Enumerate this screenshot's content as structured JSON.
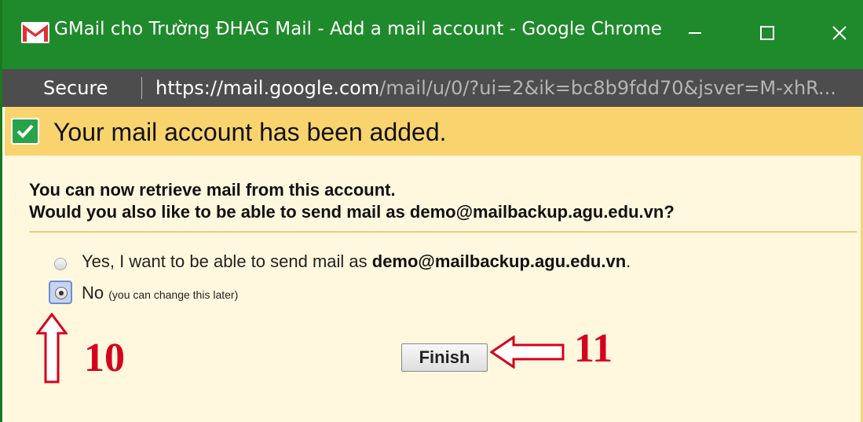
{
  "window": {
    "title": "GMail cho Trường ĐHAG Mail - Add a mail account - Google Chrome",
    "minimize_label": "—",
    "maximize_label": "☐",
    "close_label": "✕"
  },
  "addressbar": {
    "secure_label": "Secure",
    "url_scheme": "https://",
    "url_host": "mail.google.com",
    "url_path": "/mail/u/0/?ui=2&ik=bc8b9fdd70&jsver=M-xhR..."
  },
  "dialog": {
    "header": "Your mail account has been added.",
    "message_line1": "You can now retrieve mail from this account.",
    "message_line2": "Would you also like to be able to send mail as demo@mailbackup.agu.edu.vn?",
    "option_yes_prefix": "Yes, I want to be able to send mail as ",
    "option_yes_email": "demo@mailbackup.agu.edu.vn",
    "option_yes_suffix": ".",
    "option_no_label": "No",
    "option_no_hint": "(you can change this later)",
    "selected_option": "No",
    "finish_label": "Finish"
  },
  "annotations": {
    "step10": "10",
    "step11": "11",
    "arrow_color": "#d6001c"
  },
  "colors": {
    "titlebar": "#1f8a2b",
    "addressbar": "#4d4d4d",
    "header_bg": "#f9d46e",
    "content_bg": "#fff8de"
  }
}
